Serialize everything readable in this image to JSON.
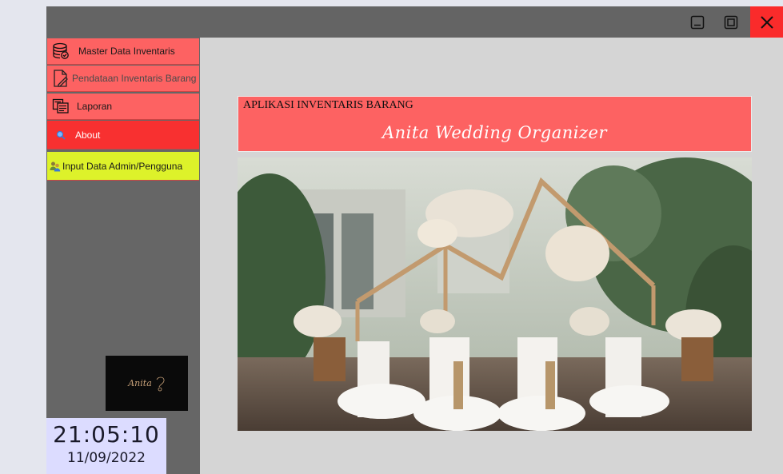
{
  "sidebar": {
    "items": [
      {
        "label": "Master Data Inventaris",
        "icon": "database-icon"
      },
      {
        "label": "Pendataan Inventaris Barang",
        "icon": "document-edit-icon"
      },
      {
        "label": "Laporan",
        "icon": "report-icon"
      },
      {
        "label": "About",
        "icon": "search-icon"
      },
      {
        "label": "Input Data Admin/Pengguna",
        "icon": "users-icon"
      }
    ],
    "logo_text": "Anita",
    "clock": {
      "time": "21:05:10",
      "date": "11/09/2022"
    }
  },
  "header": {
    "app_title": "APLIKASI INVENTARIS BARANG",
    "brand_name": "Anita Wedding Organizer"
  },
  "colors": {
    "menu_bg": "#fd6262",
    "menu_active": "#f83030",
    "menu_admin": "#ddf22a",
    "sidebar_bg": "#666666",
    "close_button": "#fa2b2b"
  }
}
